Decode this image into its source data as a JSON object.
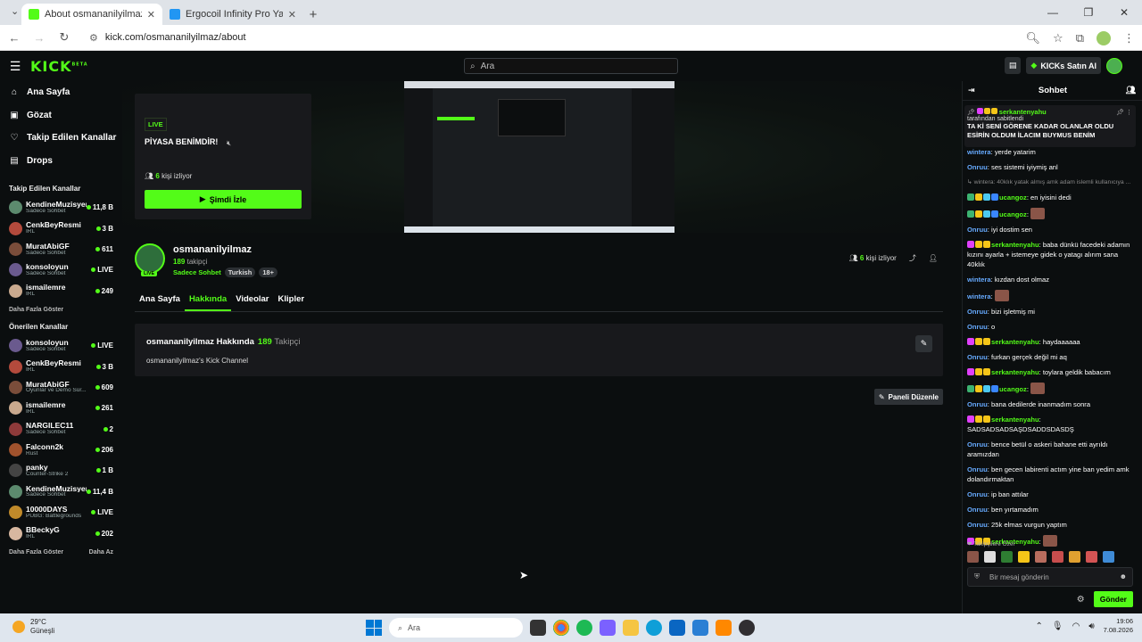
{
  "browser": {
    "tabs": [
      {
        "title": "About osmananilyilmaz - Watc",
        "active": true,
        "favicon_color": "#53fc18"
      },
      {
        "title": "Ergocoil Infinity Pro Yaylı Yatak",
        "active": false,
        "favicon_color": "#2196f3"
      }
    ],
    "url": "kick.com/osmananilyilmaz/about"
  },
  "header": {
    "logo": "KICK",
    "logo_sup": "BETA",
    "search_placeholder": "Ara",
    "buy_kicks": "KICKs Satın Al"
  },
  "sidebar": {
    "nav": [
      {
        "label": "Ana Sayfa",
        "icon": "home-icon",
        "glyph": "⌂"
      },
      {
        "label": "Gözat",
        "icon": "browse-icon",
        "glyph": "▣"
      },
      {
        "label": "Takip Edilen Kanallar",
        "icon": "heart-icon",
        "glyph": "♡"
      },
      {
        "label": "Drops",
        "icon": "drops-icon",
        "glyph": "▤"
      }
    ],
    "followed_title": "Takip Edilen Kanallar",
    "followed": [
      {
        "name": "KendineMuzisyen",
        "category": "Sadece Sohbet",
        "viewers": "11,8 B",
        "color": "#5c8a6e"
      },
      {
        "name": "CenkBeyResmi",
        "category": "IRL",
        "viewers": "3 B",
        "color": "#b34a3c"
      },
      {
        "name": "MuratAbiGF",
        "category": "Sadece Sohbet",
        "viewers": "611",
        "color": "#7a4d3a"
      },
      {
        "name": "konsoloyun",
        "category": "Sadece Sohbet",
        "viewers": "LIVE",
        "color": "#6a5a8e"
      },
      {
        "name": "ismailemre",
        "category": "IRL",
        "viewers": "249",
        "color": "#c9a98e"
      }
    ],
    "followed_more": "Daha Fazla Göster",
    "recommended_title": "Önerilen Kanallar",
    "recommended": [
      {
        "name": "konsoloyun",
        "category": "Sadece Sohbet",
        "viewers": "LIVE",
        "color": "#6a5a8e"
      },
      {
        "name": "CenkBeyResmi",
        "category": "IRL",
        "viewers": "3 B",
        "color": "#b34a3c"
      },
      {
        "name": "MuratAbiGF",
        "category": "Oyunlar ve Demo Sür...",
        "viewers": "609",
        "color": "#7a4d3a"
      },
      {
        "name": "ismailemre",
        "category": "IRL",
        "viewers": "261",
        "color": "#c9a98e"
      },
      {
        "name": "NARGILEC11",
        "category": "Sadece Sohbet",
        "viewers": "2",
        "color": "#8e3a3a"
      },
      {
        "name": "Falconn2k",
        "category": "Rust",
        "viewers": "206",
        "color": "#a0522d"
      },
      {
        "name": "panky",
        "category": "Counter-Strike 2",
        "viewers": "1 B",
        "color": "#444"
      },
      {
        "name": "KendineMuzisyen",
        "category": "Sadece Sohbet",
        "viewers": "11,4 B",
        "color": "#5c8a6e"
      },
      {
        "name": "10000DAYS",
        "category": "PUBG: Battlegrounds",
        "viewers": "LIVE",
        "color": "#c08a2a"
      },
      {
        "name": "BBeckyG",
        "category": "IRL",
        "viewers": "202",
        "color": "#d7b7a0"
      }
    ],
    "recommended_more": "Daha Fazla Göster",
    "recommended_less": "Daha Az"
  },
  "offline_card": {
    "live_label": "LIVE",
    "title": "PİYASA BENİMDİR!",
    "viewers_count": "6",
    "viewers_label": "kişi izliyor",
    "watch_button": "Şimdi İzle"
  },
  "channel": {
    "name": "osmananilyilmaz",
    "avatar_live": "LIVE",
    "followers_count": "189",
    "followers_label": "takipçi",
    "category": "Sadece Sohbet",
    "tags": [
      "Turkish",
      "18+"
    ],
    "viewers_count": "6",
    "viewers_label": "kişi izliyor",
    "tabs": [
      "Ana Sayfa",
      "Hakkında",
      "Videolar",
      "Klipler"
    ],
    "active_tab": 1
  },
  "about": {
    "heading": "osmananilyilmaz Hakkında",
    "followers_count": "189",
    "followers_label": "Takipçi",
    "description": "osmananilyilmaz's Kick Channel",
    "edit_panels": "Paneli Düzenle"
  },
  "chat": {
    "title": "Sohbet",
    "pinned": {
      "user": "serkantenyahu",
      "by": "tarafından sabitlendi",
      "message": "TA Kİ SENİ GÖRENE KADAR OLANLAR OLDU ESİRİN OLDUM İLACIM BUYMUS BENİM"
    },
    "messages": [
      {
        "user": "wintera",
        "color": "#66aaff",
        "text": "yerde yatarim",
        "badges": []
      },
      {
        "user": "Onruu",
        "color": "#66aaff",
        "text": "ses sistemi iyiymiş anl",
        "badges": []
      },
      {
        "user": "",
        "color": "#888",
        "text": "↳ wintera: 40klık yatak almış amk adam islemli kullanıcıya ...",
        "badges": [],
        "reply": true
      },
      {
        "user": "ucangoz",
        "color": "#53fc18",
        "text": "en iyisini dedi",
        "badges": [
          "#3cb371",
          "#f5c518",
          "#4cc9f0",
          "#3a86ff"
        ]
      },
      {
        "user": "ucangoz",
        "color": "#53fc18",
        "text": "",
        "badges": [
          "#3cb371",
          "#f5c518",
          "#4cc9f0",
          "#3a86ff"
        ],
        "emote": true
      },
      {
        "user": "Onruu",
        "color": "#66aaff",
        "text": "iyi dostim sen",
        "badges": []
      },
      {
        "user": "serkantenyahu",
        "color": "#53fc18",
        "text": "baba dünkü facedeki adamın kızını ayarla + istemeye gidek o yatagı alırım sana 40klık",
        "badges": [
          "#e040fb",
          "#f5c518",
          "#f5c518"
        ]
      },
      {
        "user": "wintera",
        "color": "#66aaff",
        "text": "kızdan dost olmaz",
        "badges": []
      },
      {
        "user": "wintera",
        "color": "#66aaff",
        "text": "",
        "badges": [],
        "emote": true
      },
      {
        "user": "Onruu",
        "color": "#66aaff",
        "text": "bizi işletmiş mi",
        "badges": []
      },
      {
        "user": "Onruu",
        "color": "#66aaff",
        "text": "o",
        "badges": []
      },
      {
        "user": "serkantenyahu",
        "color": "#53fc18",
        "text": "haydaaaaaa",
        "badges": [
          "#e040fb",
          "#f5c518",
          "#f5c518"
        ]
      },
      {
        "user": "Onruu",
        "color": "#66aaff",
        "text": "furkan gerçek değil mi aq",
        "badges": []
      },
      {
        "user": "serkantenyahu",
        "color": "#53fc18",
        "text": "toylara geldik babacım",
        "badges": [
          "#e040fb",
          "#f5c518",
          "#f5c518"
        ]
      },
      {
        "user": "ucangoz",
        "color": "#53fc18",
        "text": "",
        "badges": [
          "#3cb371",
          "#f5c518",
          "#4cc9f0",
          "#3a86ff"
        ],
        "emote": true
      },
      {
        "user": "Onruu",
        "color": "#66aaff",
        "text": "bana dedilerde inanmadım sonra",
        "badges": []
      },
      {
        "user": "serkantenyahu",
        "color": "#53fc18",
        "text": "SADSADSADSAŞDSADDSDASDŞ",
        "badges": [
          "#e040fb",
          "#f5c518",
          "#f5c518"
        ]
      },
      {
        "user": "Onruu",
        "color": "#66aaff",
        "text": "bence betül o askeri bahane etti ayrıldı aramızdan",
        "badges": []
      },
      {
        "user": "Onruu",
        "color": "#66aaff",
        "text": "ben gecen labirenti actım yine ban yedim amk dolandırmaktan",
        "badges": []
      },
      {
        "user": "Onruu",
        "color": "#66aaff",
        "text": "ip ban attılar",
        "badges": []
      },
      {
        "user": "Onruu",
        "color": "#66aaff",
        "text": "ben yırtamadım",
        "badges": []
      },
      {
        "user": "Onruu",
        "color": "#66aaff",
        "text": "25k elmas vurgun yaptım",
        "badges": []
      },
      {
        "user": "serkantenyahu",
        "color": "#53fc18",
        "text": "",
        "badges": [
          "#e040fb",
          "#f5c518",
          "#f5c518"
        ],
        "emote": true
      }
    ],
    "followers_only": "❤ Takipçilere Özel",
    "input_placeholder": "Bir mesaj gönderin",
    "send": "Gönder"
  },
  "taskbar": {
    "temperature": "29°C",
    "weather": "Güneşli",
    "search": "Ara",
    "time": "19:06",
    "date": "7.08.2026"
  },
  "colors": {
    "accent": "#53fc18",
    "bg": "#0b0e0f",
    "panel": "#18191c"
  }
}
